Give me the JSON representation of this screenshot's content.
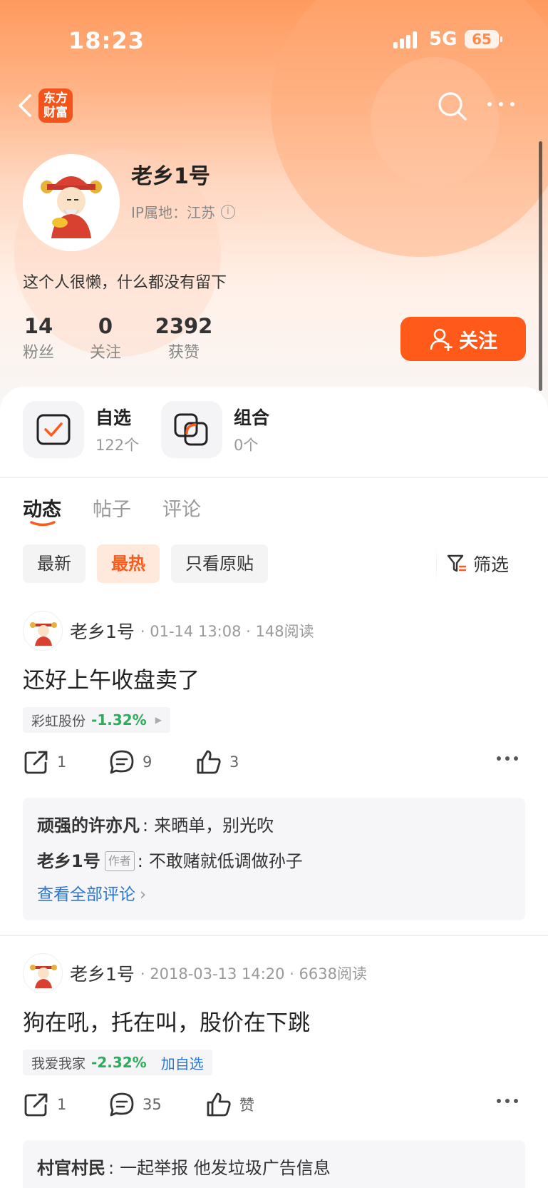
{
  "status_bar": {
    "time": "18:23",
    "network": "5G",
    "battery": "65"
  },
  "header": {
    "logo_text_line1": "东方",
    "logo_text_line2": "财富"
  },
  "profile": {
    "username": "老乡1号",
    "ip_label": "IP属地：江苏",
    "bio": "这个人很懒，什么都没有留下",
    "stats": [
      {
        "value": "14",
        "label": "粉丝"
      },
      {
        "value": "0",
        "label": "关注"
      },
      {
        "value": "2392",
        "label": "获赞"
      }
    ],
    "follow_label": "关注"
  },
  "quick_links": [
    {
      "title": "自选",
      "sub": "122个"
    },
    {
      "title": "组合",
      "sub": "0个"
    }
  ],
  "tabs": [
    {
      "label": "动态",
      "active": true
    },
    {
      "label": "帖子",
      "active": false
    },
    {
      "label": "评论",
      "active": false
    }
  ],
  "filters": [
    {
      "label": "最新",
      "active": false
    },
    {
      "label": "最热",
      "active": true
    },
    {
      "label": "只看原贴",
      "active": false
    }
  ],
  "filter_button": "筛选",
  "colors": {
    "accent": "#ff5a1a",
    "link": "#2b76d6",
    "down": "#2bad5b"
  },
  "posts": [
    {
      "author": "老乡1号",
      "meta": "· 01-14 13:08 · 148阅读",
      "title": "还好上午收盘卖了",
      "stock_name": "彩虹股份",
      "stock_pct": "-1.32%",
      "share_count": "1",
      "comment_count": "9",
      "like_count": "3",
      "comments": [
        {
          "name": "顽强的许亦凡",
          "text": "来晒单，别光吹"
        },
        {
          "name": "老乡1号",
          "badge": "作者",
          "text": "不敢赌就低调做孙子"
        }
      ],
      "view_all": "查看全部评论"
    },
    {
      "author": "老乡1号",
      "meta": "· 2018-03-13 14:20 · 6638阅读",
      "title": "狗在吼，托在叫，股价在下跳",
      "stock_name": "我爱我家",
      "stock_pct": "-2.32%",
      "stock_add": "加自选",
      "share_count": "1",
      "comment_count": "35",
      "like_count": "赞",
      "comments": [
        {
          "name": "村官村民",
          "text": "一起举报 他发垃圾广告信息"
        }
      ]
    }
  ]
}
